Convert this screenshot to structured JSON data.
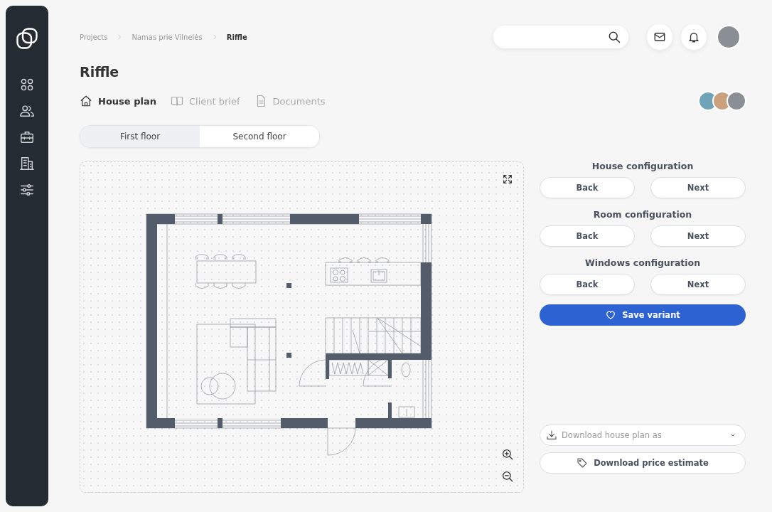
{
  "breadcrumbs": [
    {
      "label": "Projects",
      "current": false
    },
    {
      "label": "Namas prie Vilnelės",
      "current": false
    },
    {
      "label": "Riffle",
      "current": true
    }
  ],
  "title": "Riffle",
  "tabs": [
    {
      "label": "House plan",
      "kind": "house",
      "selected": true
    },
    {
      "label": "Client brief",
      "kind": "book",
      "selected": false
    },
    {
      "label": "Documents",
      "kind": "document",
      "selected": false
    }
  ],
  "floors": [
    {
      "label": "First floor",
      "selected": true
    },
    {
      "label": "Second floor",
      "selected": false
    }
  ],
  "configurations": [
    {
      "title": "House configuration",
      "back": "Back",
      "next": "Next"
    },
    {
      "title": "Room configuration",
      "back": "Back",
      "next": "Next"
    },
    {
      "title": "Windows configuration",
      "back": "Back",
      "next": "Next"
    }
  ],
  "save_button": "Save variant",
  "download_plan": {
    "placeholder": "Download house plan as"
  },
  "price_button": "Download price estimate"
}
